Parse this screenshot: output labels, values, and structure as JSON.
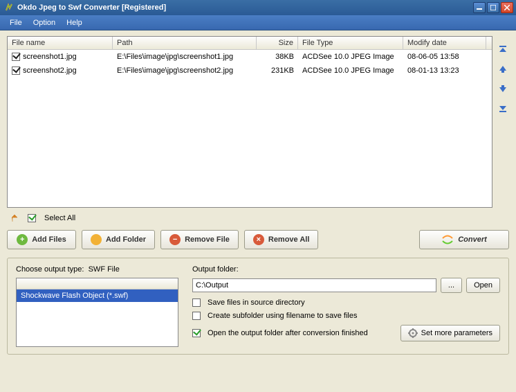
{
  "title": "Okdo Jpeg to Swf Converter [Registered]",
  "menu": {
    "file": "File",
    "option": "Option",
    "help": "Help"
  },
  "columns": {
    "name": "File name",
    "path": "Path",
    "size": "Size",
    "type": "File Type",
    "date": "Modify date"
  },
  "files": [
    {
      "name": "screenshot1.jpg",
      "path": "E:\\Files\\image\\jpg\\screenshot1.jpg",
      "size": "38KB",
      "type": "ACDSee 10.0 JPEG Image",
      "date": "08-06-05 13:58"
    },
    {
      "name": "screenshot2.jpg",
      "path": "E:\\Files\\image\\jpg\\screenshot2.jpg",
      "size": "231KB",
      "type": "ACDSee 10.0 JPEG Image",
      "date": "08-01-13 13:23"
    }
  ],
  "select_all": "Select All",
  "toolbar": {
    "add_files": "Add Files",
    "add_folder": "Add Folder",
    "remove_file": "Remove File",
    "remove_all": "Remove All",
    "convert": "Convert"
  },
  "output_type": {
    "label": "Choose output type:",
    "current": "SWF File",
    "option": "Shockwave Flash Object (*.swf)"
  },
  "output": {
    "label": "Output folder:",
    "path": "C:\\Output",
    "browse": "...",
    "open": "Open"
  },
  "options": {
    "save_source": "Save files in source directory",
    "subfolder": "Create subfolder using filename to save files",
    "open_after": "Open the output folder after conversion finished",
    "more_params": "Set more parameters"
  }
}
